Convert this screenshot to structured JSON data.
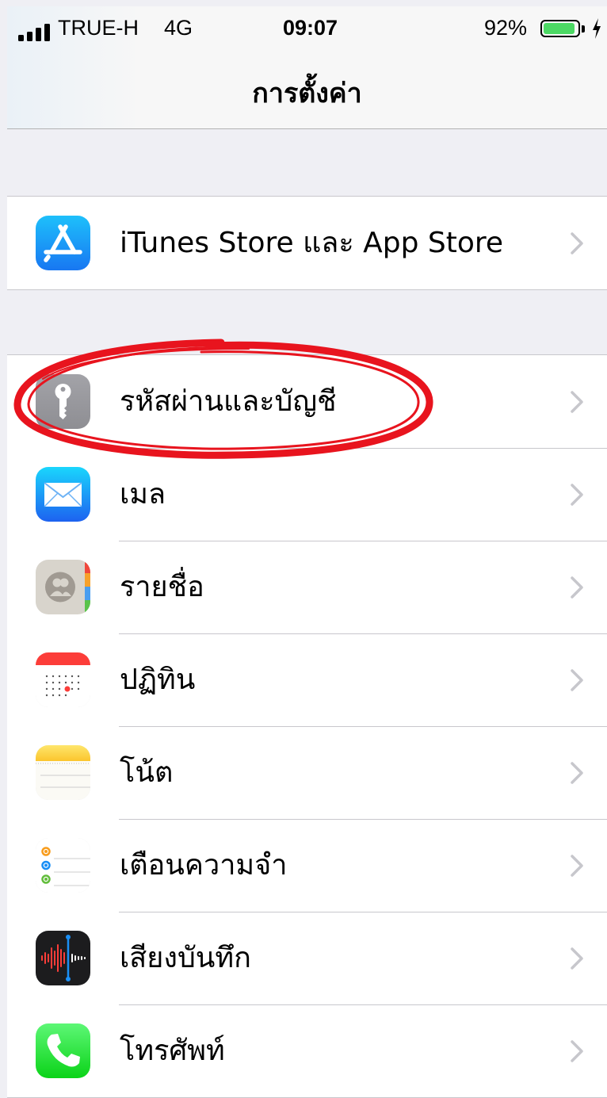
{
  "status_bar": {
    "carrier": "TRUE-H",
    "network": "4G",
    "time": "09:07",
    "battery": "92%",
    "battery_level": 0.92
  },
  "nav": {
    "title": "การตั้งค่า"
  },
  "groups": [
    {
      "items": [
        {
          "label": "iTunes Store และ App Store",
          "icon": "app-store-icon"
        }
      ]
    },
    {
      "items": [
        {
          "label": "รหัสผ่านและบัญชี",
          "icon": "key-icon",
          "highlighted": true
        },
        {
          "label": "เมล",
          "icon": "mail-icon"
        },
        {
          "label": "รายชื่อ",
          "icon": "contacts-icon"
        },
        {
          "label": "ปฏิทิน",
          "icon": "calendar-icon"
        },
        {
          "label": "โน้ต",
          "icon": "notes-icon"
        },
        {
          "label": "เตือนความจำ",
          "icon": "reminders-icon"
        },
        {
          "label": "เสียงบันทึก",
          "icon": "voice-memos-icon"
        },
        {
          "label": "โทรศัพท์",
          "icon": "phone-icon"
        }
      ]
    }
  ],
  "colors": {
    "background": "#efeff4",
    "separator": "#c8c7cc",
    "chevron": "#c7c7cc",
    "battery": "#4cd964",
    "highlight": "#e8141e"
  }
}
